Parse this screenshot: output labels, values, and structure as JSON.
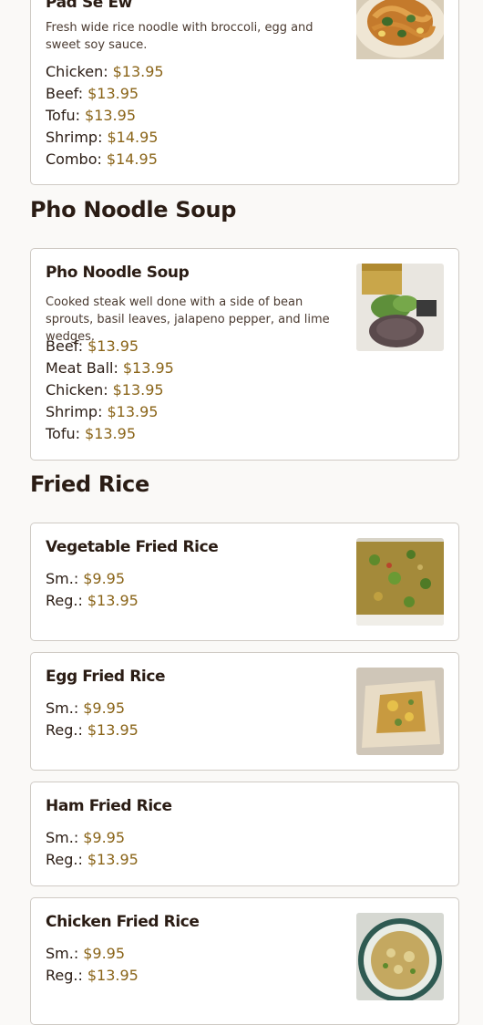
{
  "items_top": {
    "pad_se_ew": {
      "name": "Pad Se Ew",
      "description": "Fresh wide rice noodle with broccoli, egg and sweet soy sauce.",
      "prices": [
        {
          "label": "Chicken:",
          "price": "$13.95"
        },
        {
          "label": "Beef:",
          "price": "$13.95"
        },
        {
          "label": "Tofu:",
          "price": "$13.95"
        },
        {
          "label": "Shrimp:",
          "price": "$14.95"
        },
        {
          "label": "Combo:",
          "price": "$14.95"
        }
      ]
    }
  },
  "sections": {
    "pho": {
      "title": "Pho Noodle Soup",
      "item": {
        "name": "Pho Noodle Soup",
        "description": "Cooked steak well done with a side of bean sprouts, basil leaves, jalapeno pepper, and lime wedges.",
        "prices": [
          {
            "label": "Beef:",
            "price": "$13.95"
          },
          {
            "label": "Meat Ball:",
            "price": "$13.95"
          },
          {
            "label": "Chicken:",
            "price": "$13.95"
          },
          {
            "label": "Shrimp:",
            "price": "$13.95"
          },
          {
            "label": "Tofu:",
            "price": "$13.95"
          }
        ]
      }
    },
    "fried_rice": {
      "title": "Fried Rice",
      "items": [
        {
          "name": "Vegetable Fried Rice",
          "prices": [
            {
              "label": "Sm.:",
              "price": "$9.95"
            },
            {
              "label": "Reg.:",
              "price": "$13.95"
            }
          ]
        },
        {
          "name": "Egg Fried Rice",
          "prices": [
            {
              "label": "Sm.:",
              "price": "$9.95"
            },
            {
              "label": "Reg.:",
              "price": "$13.95"
            }
          ]
        },
        {
          "name": "Ham Fried Rice",
          "prices": [
            {
              "label": "Sm.:",
              "price": "$9.95"
            },
            {
              "label": "Reg.:",
              "price": "$13.95"
            }
          ]
        },
        {
          "name": "Chicken Fried Rice",
          "prices": [
            {
              "label": "Sm.:",
              "price": "$9.95"
            },
            {
              "label": "Reg.:",
              "price": "$13.95"
            }
          ]
        }
      ]
    }
  },
  "colors": {
    "price": "#8a6418",
    "text": "#2a1c14",
    "card_border": "#cfcac4",
    "background": "#faf9f7"
  },
  "icons": [
    "food-photo"
  ]
}
